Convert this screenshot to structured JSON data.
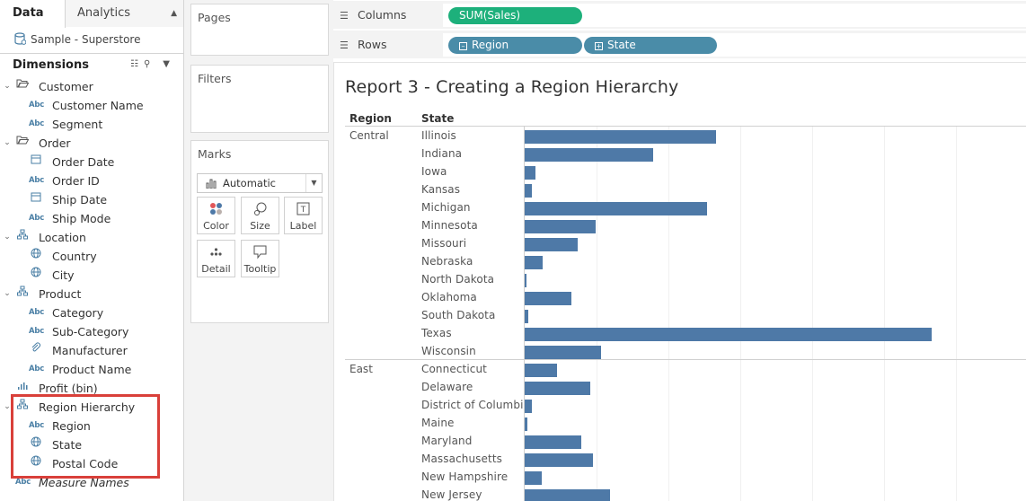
{
  "left_pane": {
    "tabs": {
      "data": "Data",
      "analytics": "Analytics"
    },
    "datasource": "Sample - Superstore",
    "dimensions_header": "Dimensions",
    "tree": [
      {
        "type": "folder",
        "label": "Customer",
        "icon": "folder-open-icon"
      },
      {
        "type": "field",
        "label": "Customer Name",
        "icon": "abc-string-icon"
      },
      {
        "type": "field",
        "label": "Segment",
        "icon": "abc-string-icon"
      },
      {
        "type": "folder",
        "label": "Order",
        "icon": "folder-open-icon"
      },
      {
        "type": "field",
        "label": "Order Date",
        "icon": "calendar-icon"
      },
      {
        "type": "field",
        "label": "Order ID",
        "icon": "abc-string-icon"
      },
      {
        "type": "field",
        "label": "Ship Date",
        "icon": "calendar-icon"
      },
      {
        "type": "field",
        "label": "Ship Mode",
        "icon": "abc-string-icon"
      },
      {
        "type": "folder",
        "label": "Location",
        "icon": "hierarchy-icon"
      },
      {
        "type": "field",
        "label": "Country",
        "icon": "globe-icon"
      },
      {
        "type": "field",
        "label": "City",
        "icon": "globe-icon"
      },
      {
        "type": "folder",
        "label": "Product",
        "icon": "hierarchy-icon"
      },
      {
        "type": "field",
        "label": "Category",
        "icon": "abc-string-icon"
      },
      {
        "type": "field",
        "label": "Sub-Category",
        "icon": "abc-string-icon"
      },
      {
        "type": "field",
        "label": "Manufacturer",
        "icon": "paperclip-icon"
      },
      {
        "type": "field",
        "label": "Product Name",
        "icon": "abc-string-icon"
      },
      {
        "type": "top",
        "label": "Profit (bin)",
        "icon": "bin-bars-icon"
      },
      {
        "type": "folder",
        "label": "Region Hierarchy",
        "icon": "hierarchy-icon"
      },
      {
        "type": "field",
        "label": "Region",
        "icon": "abc-string-icon"
      },
      {
        "type": "field",
        "label": "State",
        "icon": "globe-icon"
      },
      {
        "type": "field",
        "label": "Postal Code",
        "icon": "globe-icon"
      },
      {
        "type": "top",
        "label": "Measure Names",
        "icon": "abc-string-icon"
      }
    ]
  },
  "cards": {
    "pages": "Pages",
    "filters": "Filters",
    "marks": "Marks",
    "mark_type": "Automatic",
    "mark_buttons": {
      "color": "Color",
      "size": "Size",
      "label": "Label",
      "detail": "Detail",
      "tooltip": "Tooltip"
    }
  },
  "shelves": {
    "columns_label": "Columns",
    "rows_label": "Rows",
    "columns_pills": [
      "SUM(Sales)"
    ],
    "rows_pills": [
      "Region",
      "State"
    ]
  },
  "colors": {
    "bar": "#4e79a7",
    "measure_pill": "#1db07b",
    "dimension_pill": "#4a8ca8",
    "highlight": "#d9403a"
  },
  "viz": {
    "title": "Report 3 - Creating a Region Hierarchy",
    "headers": {
      "region": "Region",
      "state": "State"
    }
  },
  "chart_data": {
    "type": "bar",
    "orientation": "horizontal",
    "xlabel": "",
    "ylabel": "",
    "measure": "SUM(Sales)",
    "groups": [
      {
        "region": "Central",
        "categories": [
          "Illinois",
          "Indiana",
          "Iowa",
          "Kansas",
          "Michigan",
          "Minnesota",
          "Missouri",
          "Nebraska",
          "North Dakota",
          "Oklahoma",
          "South Dakota",
          "Texas",
          "Wisconsin"
        ],
        "values": [
          80166,
          53555,
          4580,
          2914,
          76270,
          29863,
          22205,
          7465,
          920,
          19683,
          1316,
          170188,
          32115
        ]
      },
      {
        "region": "East",
        "categories": [
          "Connecticut",
          "Delaware",
          "District of Columbia",
          "Maine",
          "Maryland",
          "Massachusetts",
          "New Hampshire",
          "New Jersey"
        ],
        "values": [
          13384,
          27451,
          2865,
          1271,
          23706,
          28634,
          7293,
          35764
        ]
      }
    ],
    "xlim": [
      0,
      210000
    ],
    "grid": true
  }
}
